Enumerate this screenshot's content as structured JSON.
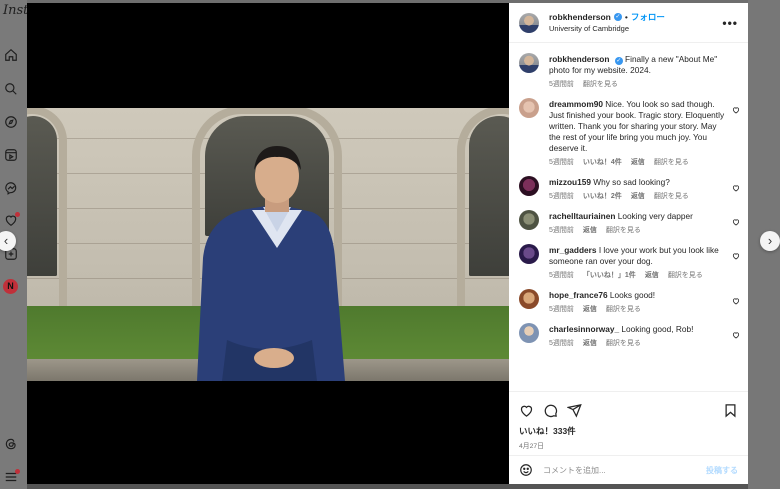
{
  "background": {
    "logo_text": "Insta",
    "nav_icons": [
      "home-icon",
      "search-icon",
      "explore-icon",
      "reels-icon",
      "messenger-icon",
      "heart-icon",
      "create-icon",
      "netflix-avatar-icon",
      "threads-icon",
      "menu-icon"
    ],
    "netflix_letter": "N"
  },
  "colors": {
    "link_blue": "#0095f6",
    "verified_blue": "#3897f0",
    "muted_text": "#737373",
    "notification_red": "#c0303a"
  },
  "post": {
    "username": "robkhenderson",
    "separator": "•",
    "follow_label": "フォロー",
    "location": "University of Cambridge",
    "more_label": "•••",
    "caption": {
      "username": "robkhenderson",
      "text": "Finally a new \"About Me\" photo for my website. 2024.",
      "time": "5週間前",
      "translate": "翻訳を見る"
    },
    "comments": [
      {
        "username": "dreammom90",
        "text": "Nice. You look so sad though. Just finished your book. Tragic story. Eloquently written. Thank you for sharing your story. May the rest of your life bring you much joy. You deserve it.",
        "time": "5週間前",
        "likes": "いいね！4件",
        "reply": "返信",
        "translate": "翻訳を見る"
      },
      {
        "username": "mizzou159",
        "text": "Why so sad looking?",
        "time": "5週間前",
        "likes": "いいね！2件",
        "reply": "返信",
        "translate": "翻訳を見る"
      },
      {
        "username": "rachelltauriainen",
        "text": "Looking very dapper",
        "time": "5週間前",
        "reply": "返信",
        "translate": "翻訳を見る"
      },
      {
        "username": "mr_gadders",
        "text": "I love your work but you look like someone ran over your dog.",
        "time": "5週間前",
        "likes": "「いいね！」1件",
        "reply": "返信",
        "translate": "翻訳を見る"
      },
      {
        "username": "hope_france76",
        "text": "Looks good!",
        "time": "5週間前",
        "reply": "返信",
        "translate": "翻訳を見る"
      },
      {
        "username": "charlesinnorway_",
        "text": "Looking good, Rob!",
        "time": "5週間前",
        "reply": "返信",
        "translate": "翻訳を見る"
      }
    ],
    "likes_count": "いいね！333件",
    "date": "4月27日",
    "comment_placeholder": "コメントを追加...",
    "post_button": "投稿する"
  },
  "navigation": {
    "prev": "‹",
    "next": "›"
  }
}
